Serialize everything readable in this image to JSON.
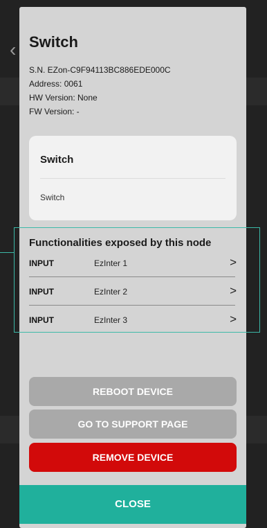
{
  "dialog": {
    "title": "Switch",
    "serial": "S.N. EZon-C9F94113BC886EDE000C",
    "address": "Address: 0061",
    "hw_version": "HW Version: None",
    "fw_version": "FW Version: -"
  },
  "card": {
    "title": "Switch",
    "subtitle": "Switch"
  },
  "functionalities": {
    "title": "Functionalities exposed by this node",
    "items": [
      {
        "type": "INPUT",
        "name": "EzInter 1"
      },
      {
        "type": "INPUT",
        "name": "EzInter 2"
      },
      {
        "type": "INPUT",
        "name": "EzInter 3"
      }
    ]
  },
  "buttons": {
    "reboot": "REBOOT DEVICE",
    "support": "GO TO SUPPORT PAGE",
    "remove": "REMOVE DEVICE",
    "close": "CLOSE"
  },
  "icons": {
    "chevron": "chevron-right-icon",
    "back": "chevron-left-icon"
  },
  "colors": {
    "accent": "#20b09c",
    "danger": "#d20a0a",
    "disabled": "#a9a9a9",
    "dialog_bg": "#d4d4d4"
  }
}
